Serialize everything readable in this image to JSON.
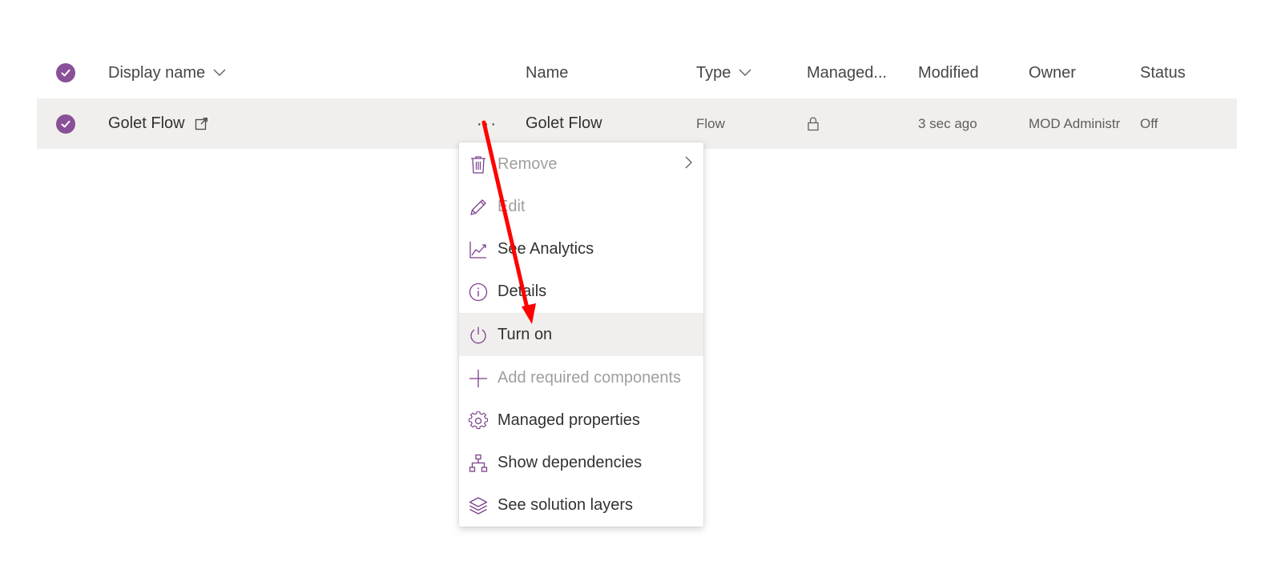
{
  "header": {
    "display_name": "Display name",
    "name": "Name",
    "type": "Type",
    "managed": "Managed...",
    "modified": "Modified",
    "owner": "Owner",
    "status": "Status"
  },
  "row": {
    "display_name": "Golet Flow",
    "more": "···",
    "name": "Golet Flow",
    "type": "Flow",
    "modified": "3 sec ago",
    "owner": "MOD Administr",
    "status": "Off"
  },
  "menu": {
    "items": [
      {
        "label": "Remove",
        "icon": "trash-icon",
        "disabled": true,
        "has_submenu": true
      },
      {
        "label": "Edit",
        "icon": "pencil-icon",
        "disabled": true
      },
      {
        "label": "See Analytics",
        "icon": "analytics-icon",
        "disabled": false
      },
      {
        "label": "Details",
        "icon": "info-icon",
        "disabled": false
      },
      {
        "label": "Turn on",
        "icon": "power-icon",
        "disabled": false,
        "highlighted": true
      },
      {
        "label": "Add required components",
        "icon": "plus-icon",
        "disabled": true
      },
      {
        "label": "Managed properties",
        "icon": "gear-icon",
        "disabled": false
      },
      {
        "label": "Show dependencies",
        "icon": "hierarchy-icon",
        "disabled": false
      },
      {
        "label": "See solution layers",
        "icon": "layers-icon",
        "disabled": false
      }
    ]
  },
  "colors": {
    "accent": "#8a4f99",
    "icon": "#7b3f8c",
    "row_selected": "#f1efee",
    "annotation_arrow": "#ff0000"
  }
}
